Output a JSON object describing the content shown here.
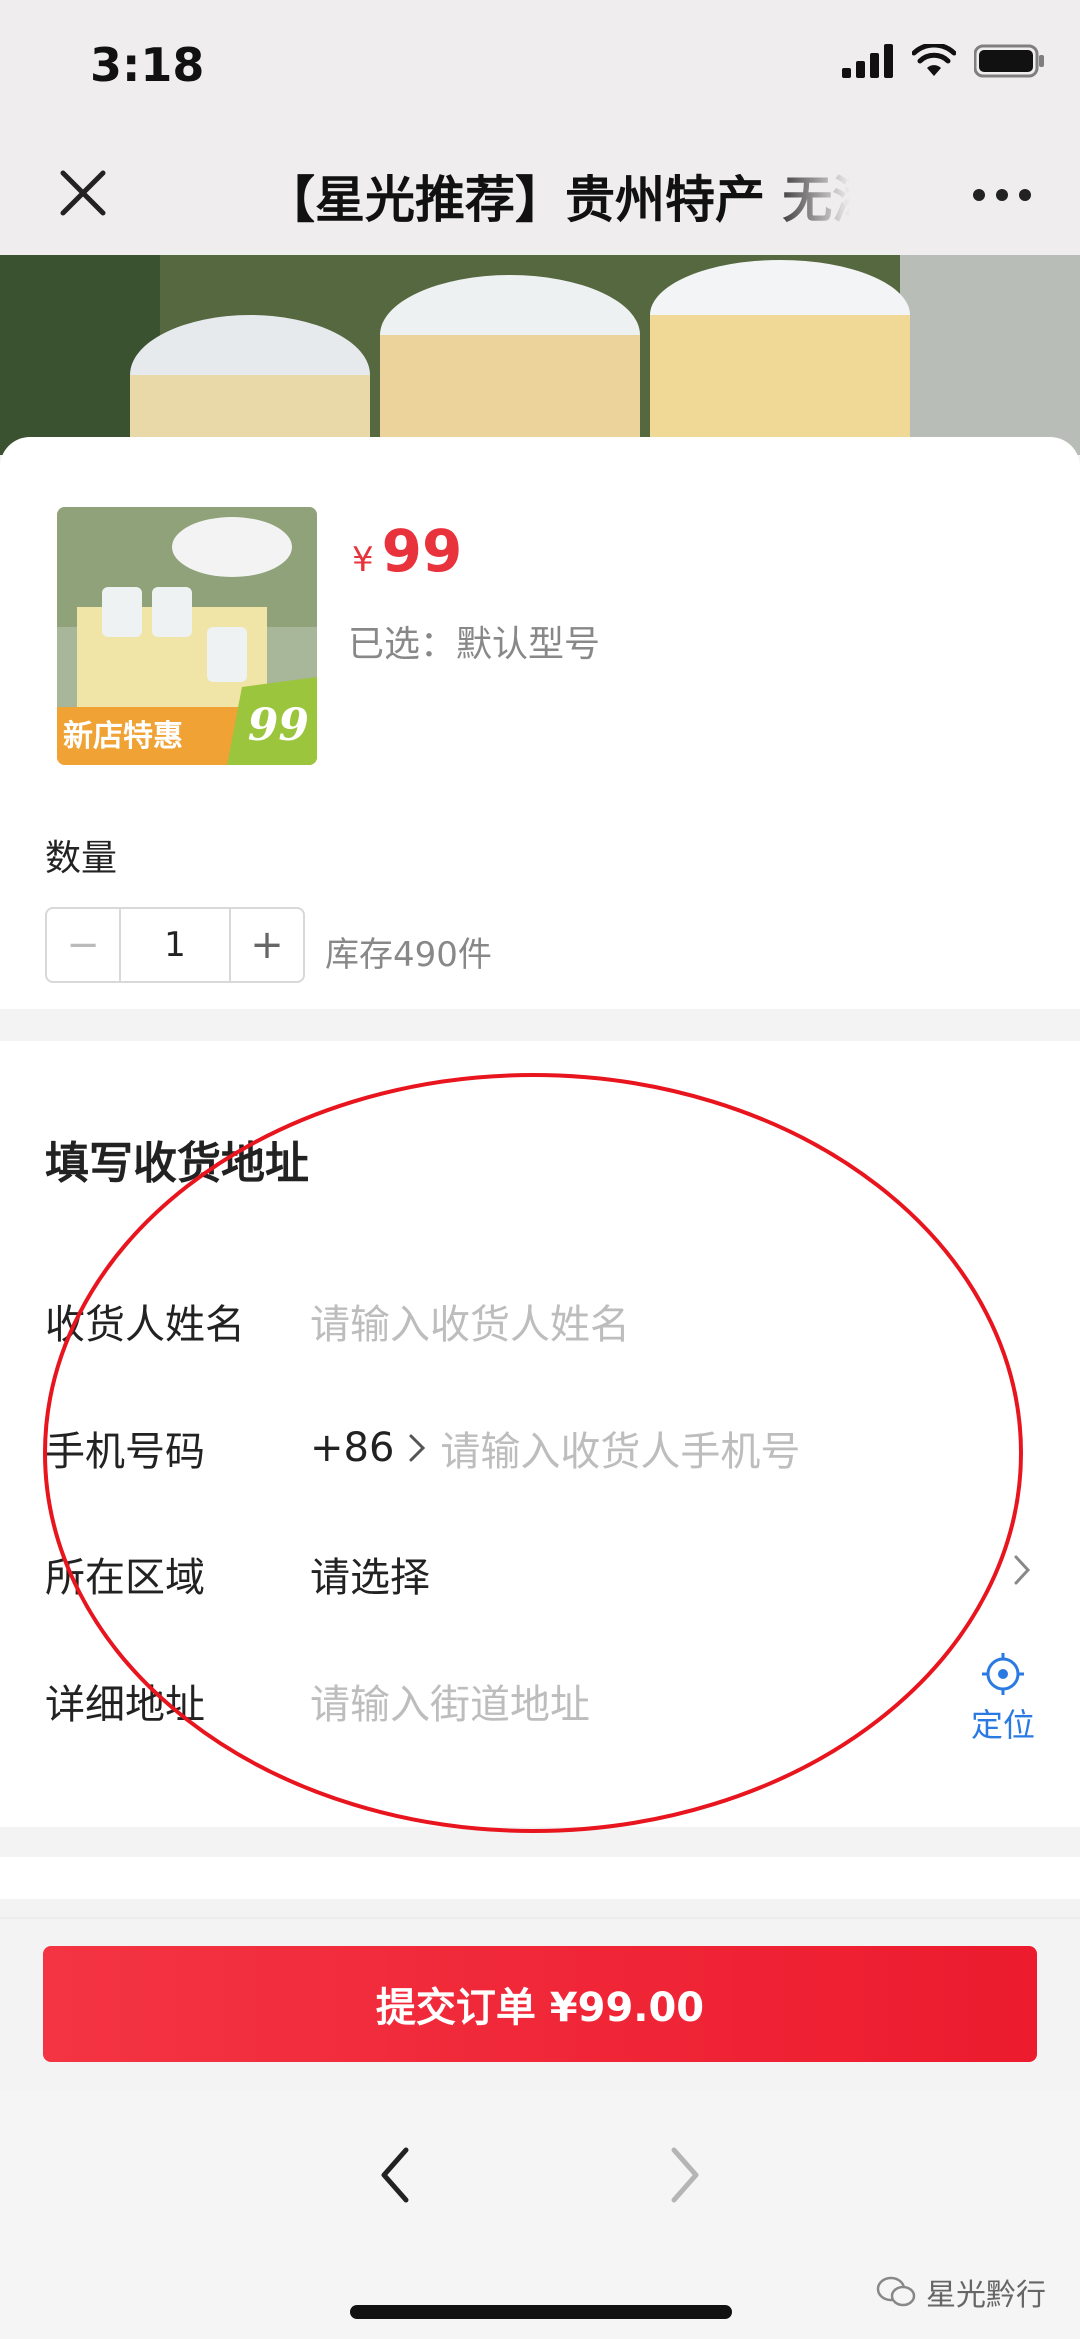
{
  "status_bar": {
    "time": "3:18"
  },
  "nav": {
    "title": "【星光推荐】贵州特产 无添加",
    "close_icon": "close-icon",
    "more_icon": "more-icon"
  },
  "product": {
    "thumbnail_caption": "新店特惠",
    "thumbnail_price": "99",
    "price_symbol": "¥",
    "price": "99",
    "selected": "已选：默认型号"
  },
  "quantity": {
    "label": "数量",
    "minus": "−",
    "value": "1",
    "plus": "+",
    "stock": "库存490件"
  },
  "address": {
    "title": "填写收货地址",
    "name_label": "收货人姓名",
    "name_placeholder": "请输入收货人姓名",
    "phone_label": "手机号码",
    "country_code": "+86",
    "phone_placeholder": "请输入收货人手机号",
    "region_label": "所在区域",
    "region_value": "请选择",
    "detail_label": "详细地址",
    "detail_placeholder": "请输入街道地址",
    "locate_label": "定位"
  },
  "submit": {
    "label": "提交订单 ¥99.00"
  },
  "watermark": {
    "text": "星光黔行"
  },
  "colors": {
    "accent_red": "#e8323c",
    "link_blue": "#2a7ae2",
    "annotation_red": "#e8141e"
  }
}
